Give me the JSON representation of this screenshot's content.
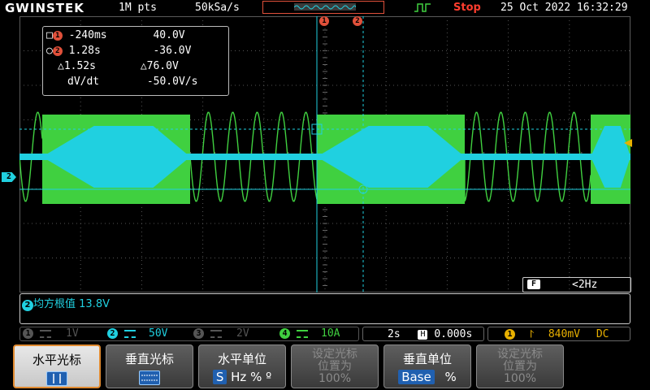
{
  "topbar": {
    "brand": "GWINSTEK",
    "record_length": "1M pts",
    "sample_rate": "50kSa/s",
    "run_state": "Stop",
    "datetime": "25 Oct 2022 16:32:29"
  },
  "cursor_markers": {
    "c1": "1",
    "c2": "2"
  },
  "readout": {
    "row1": {
      "t": "-240ms",
      "v": "40.0V"
    },
    "row2": {
      "t": "1.28s",
      "v": "-36.0V"
    },
    "row3": {
      "t": "△1.52s",
      "v": "△76.0V"
    },
    "row4": {
      "label": "dV/dt",
      "v": "-50.0V/s"
    }
  },
  "ch2_marker": "2",
  "filter": {
    "icon": "F",
    "value": "<2Hz"
  },
  "measurement": {
    "badge": "2",
    "label": "均方根值",
    "value": "13.8V"
  },
  "channels": [
    {
      "num": "1",
      "scale": "1V",
      "color": "#555555"
    },
    {
      "num": "2",
      "scale": "50V",
      "color": "#20d0e0"
    },
    {
      "num": "3",
      "scale": "2V",
      "color": "#555555"
    },
    {
      "num": "4",
      "scale": "10A",
      "color": "#40d040"
    }
  ],
  "timebase": {
    "scale": "2s",
    "h_icon": "H",
    "position": "0.000s"
  },
  "trigger": {
    "source": "1",
    "level": "840mV",
    "coupling": "DC"
  },
  "softkeys": [
    {
      "title": "水平光标",
      "state": "selected"
    },
    {
      "title": "垂直光标",
      "state": "normal"
    },
    {
      "title": "水平单位",
      "opts": [
        "S",
        "Hz",
        "%",
        "º"
      ]
    },
    {
      "title": "设定光标位置为100%",
      "line1": "设定光标",
      "line2": "位置为",
      "line3": "100%",
      "state": "disabled"
    },
    {
      "title": "垂直单位",
      "opts": [
        "Base",
        "%"
      ]
    },
    {
      "title": "设定光标位置为100%",
      "line1": "设定光标",
      "line2": "位置为",
      "line3": "100%",
      "state": "disabled"
    }
  ],
  "colors": {
    "ch2": "#20d0e0",
    "ch4": "#40d040",
    "cursor": "#e0503a",
    "trigger": "#e8b000"
  }
}
